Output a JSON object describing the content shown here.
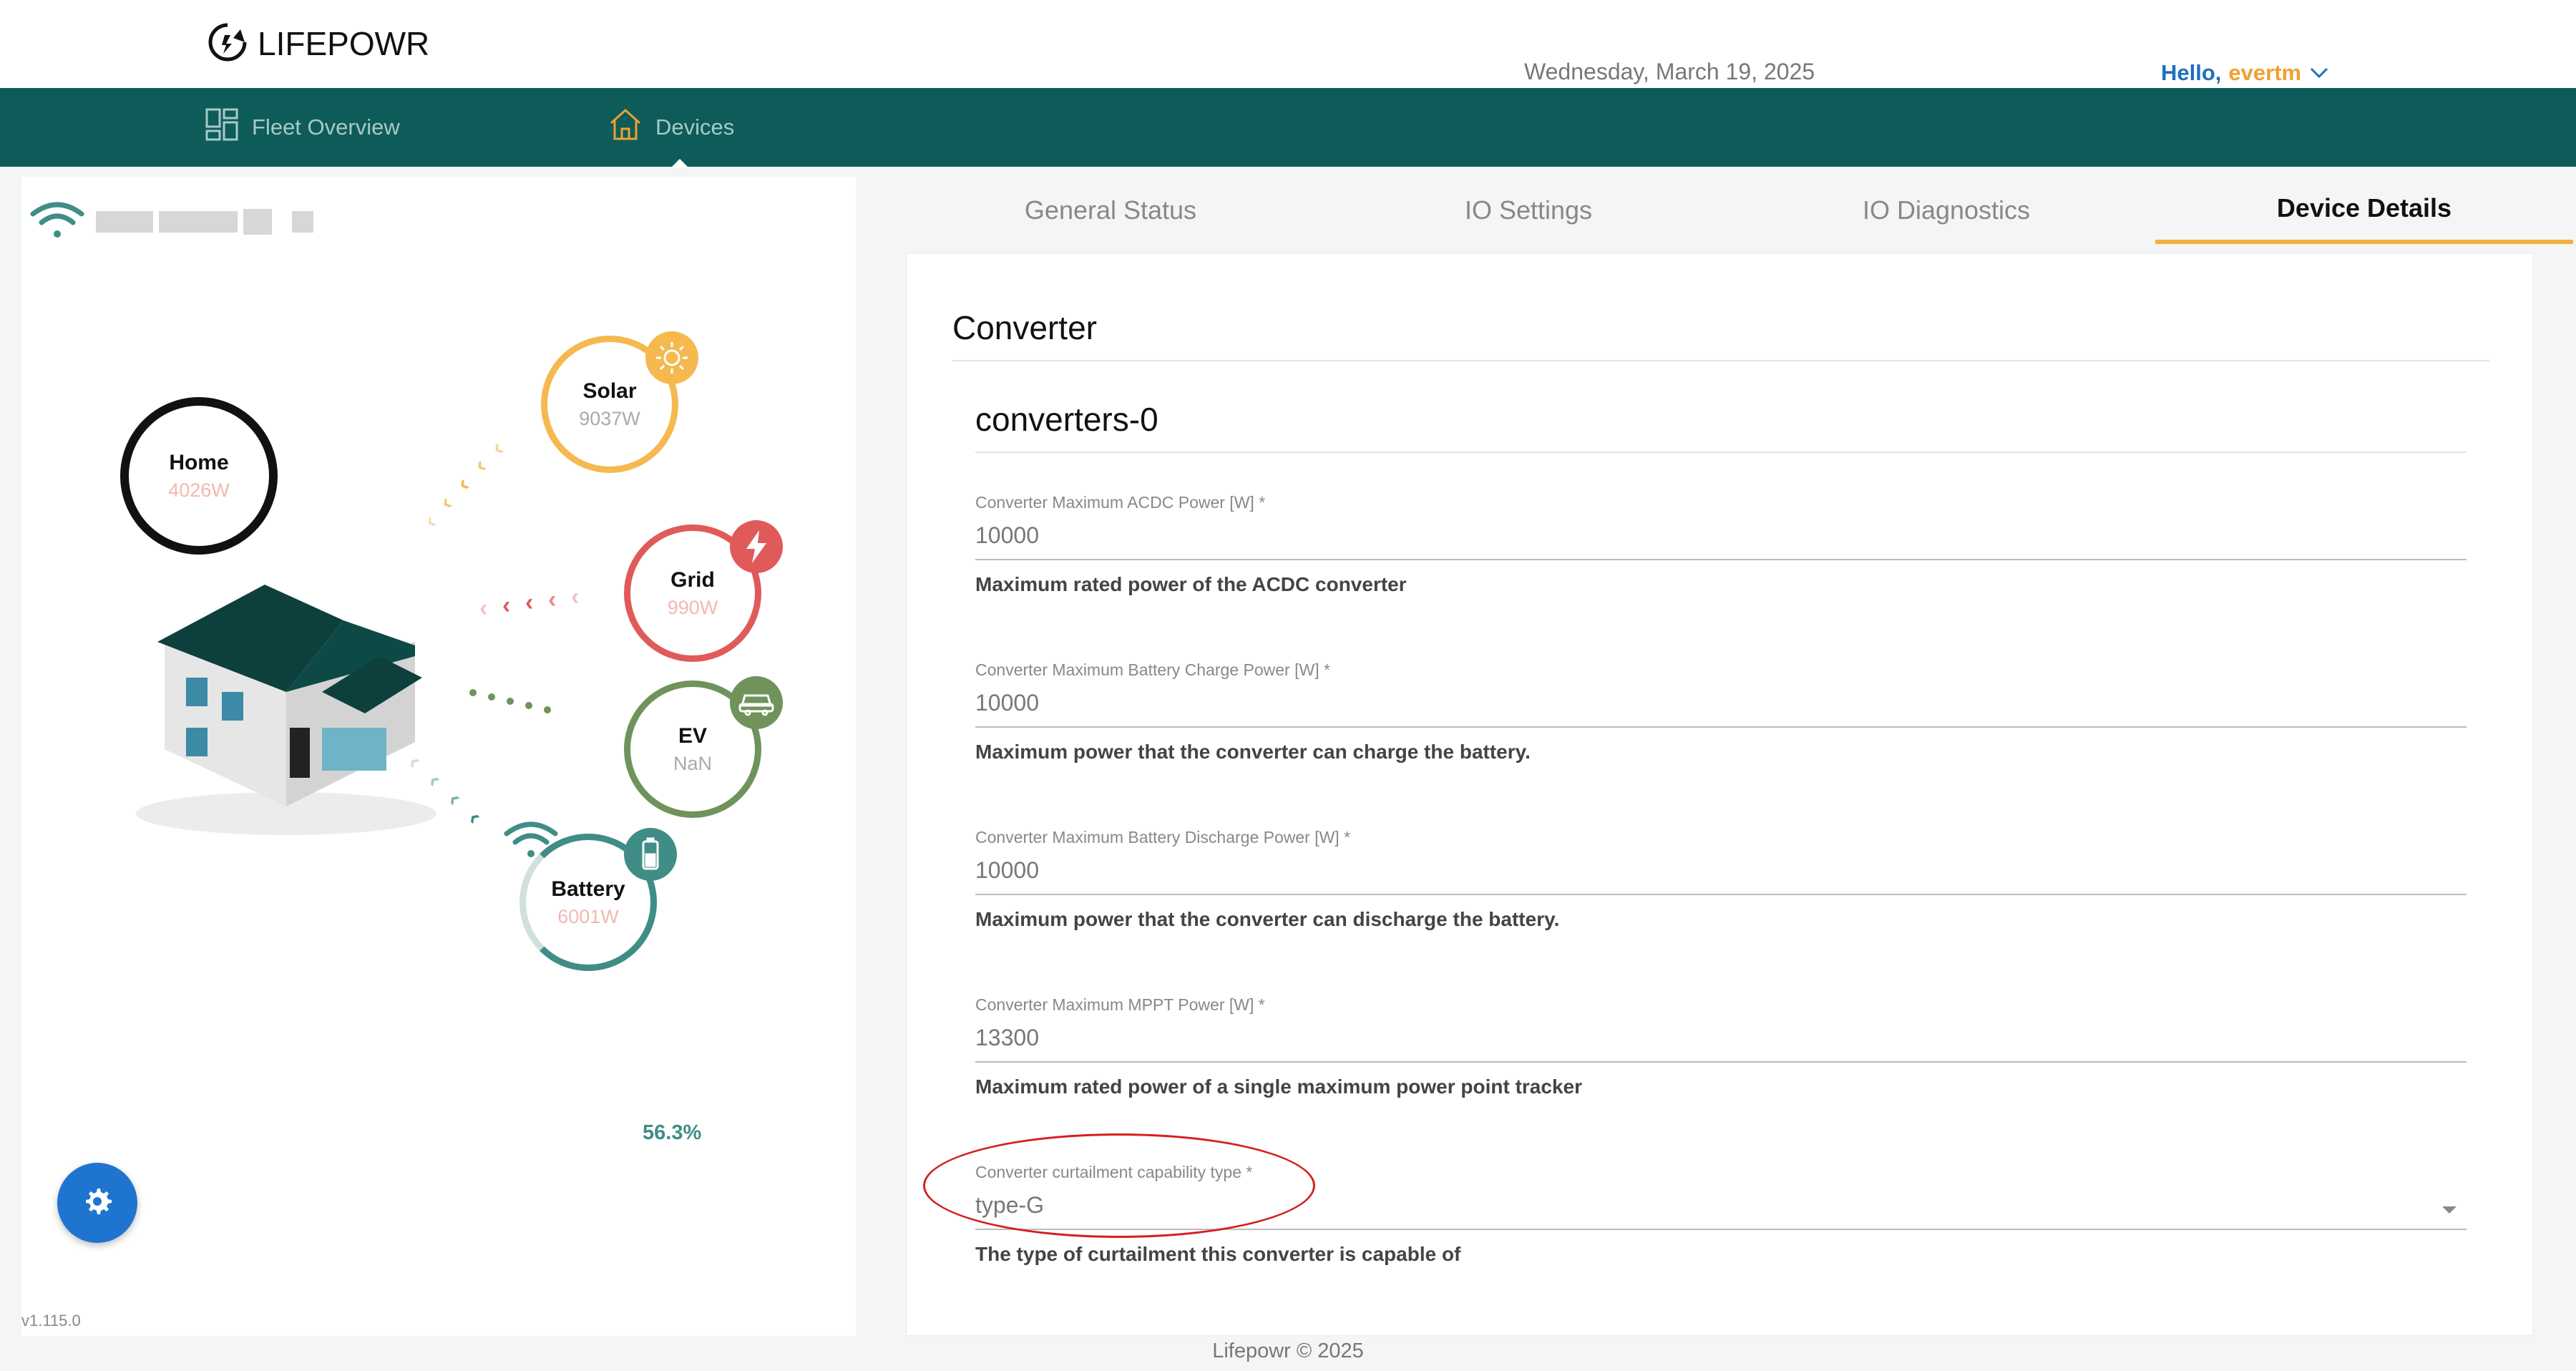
{
  "header": {
    "logo_text": "LIFEPOWR",
    "date": "Wednesday, March 19, 2025",
    "greeting": "Hello,",
    "username": "evertm"
  },
  "nav": {
    "items": [
      {
        "label": "Fleet Overview",
        "icon": "grid-icon"
      },
      {
        "label": "Devices",
        "icon": "house-icon"
      }
    ]
  },
  "energy_flow": {
    "home": {
      "label": "Home",
      "value": "4026W"
    },
    "solar": {
      "label": "Solar",
      "value": "9037W"
    },
    "grid": {
      "label": "Grid",
      "value": "990W"
    },
    "ev": {
      "label": "EV",
      "value": "NaN"
    },
    "battery": {
      "label": "Battery",
      "value": "6001W",
      "percent": "56.3%",
      "level": 0.563
    }
  },
  "version": "v1.115.0",
  "tabs": [
    {
      "label": "General Status",
      "active": false
    },
    {
      "label": "IO Settings",
      "active": false
    },
    {
      "label": "IO Diagnostics",
      "active": false
    },
    {
      "label": "Device Details",
      "active": true
    }
  ],
  "form": {
    "section_title": "Converter",
    "subsection_title": "converters-0",
    "fields": [
      {
        "label": "Converter Maximum ACDC Power [W] *",
        "value": "10000",
        "help": "Maximum rated power of the ACDC converter"
      },
      {
        "label": "Converter Maximum Battery Charge Power [W] *",
        "value": "10000",
        "help": "Maximum power that the converter can charge the battery."
      },
      {
        "label": "Converter Maximum Battery Discharge Power [W] *",
        "value": "10000",
        "help": "Maximum power that the converter can discharge the battery."
      },
      {
        "label": "Converter Maximum MPPT Power [W] *",
        "value": "13300",
        "help": "Maximum rated power of a single maximum power point tracker"
      },
      {
        "label": "Converter curtailment capability type *",
        "value": "type-G",
        "help": "The type of curtailment this converter is capable of"
      }
    ]
  },
  "footer": "Lifepowr © 2025",
  "colors": {
    "nav_bg": "#0d5c5a",
    "solar": "#f5b950",
    "grid": "#e05a5a",
    "ev": "#6f935a",
    "battery": "#3f8d86",
    "accent_tab": "#f0b040",
    "fab": "#1f74d0"
  }
}
